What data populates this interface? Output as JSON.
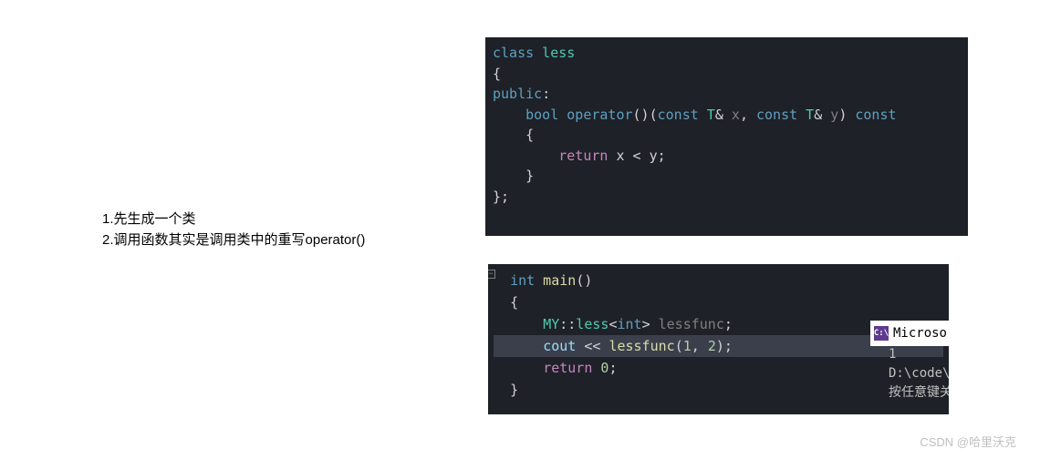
{
  "left": {
    "line1": "1.先生成一个类",
    "line2": "2.调用函数其实是调用类中的重写operator()"
  },
  "code1": {
    "l1_class": "class",
    "l1_name": " less",
    "l2": "{",
    "l3_pub": "public",
    "l3_colon": ":",
    "l4_bool": "bool",
    "l4_op": " operator",
    "l4_paren1": "()(",
    "l4_const1": "const",
    "l4_t1": " T",
    "l4_amp1": "& ",
    "l4_x": "x",
    "l4_comma": ", ",
    "l4_const2": "const",
    "l4_t2": " T",
    "l4_amp2": "& ",
    "l4_y": "y",
    "l4_paren2": ") ",
    "l4_const3": "const",
    "l5": "{",
    "l6_ret": "return",
    "l6_expr": " x < y;",
    "l7": "}",
    "l8": "};"
  },
  "code2": {
    "l1_int": "int",
    "l1_main": " main",
    "l1_paren": "()",
    "l2": "{",
    "l3_ns": "MY",
    "l3_scope": "::",
    "l3_less": "less",
    "l3_lt": "<",
    "l3_int": "int",
    "l3_gt": "> ",
    "l3_var": "lessfunc",
    "l3_semi": ";",
    "l4_cout": "cout ",
    "l4_lshift": "<< ",
    "l4_func": "lessfunc",
    "l4_call": "(",
    "l4_n1": "1",
    "l4_comma": ", ",
    "l4_n2": "2",
    "l4_end": ");",
    "l5_ret": "return",
    "l5_sp": " ",
    "l5_zero": "0",
    "l5_semi": ";",
    "l6": "}"
  },
  "ms": {
    "icon": "C:\\",
    "label": "Microso"
  },
  "console": {
    "line1": "1",
    "line2": "D:\\code\\t",
    "line3": "按任意键关"
  },
  "watermark": "CSDN @哈里沃克"
}
